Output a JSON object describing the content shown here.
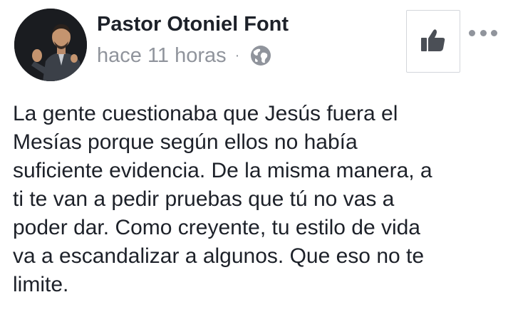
{
  "post": {
    "author": "Pastor Otoniel Font",
    "timestamp": "hace 11 horas",
    "separator": "·",
    "privacy_icon": "globe-icon",
    "avatar_icon": "profile-photo",
    "like_icon": "thumbs-up-icon",
    "more_icon": "more-options-icon",
    "text_lines": [
      "La gente cuestionaba que Jesús fuera el",
      "Mesías porque según ellos no había",
      "suficiente evidencia. De la misma manera, a",
      "ti te van a pedir pruebas que tú no vas a",
      "poder dar. Como creyente, tu estilo de vida",
      "va a escandalizar a algunos. Que eso no te",
      "limite."
    ]
  },
  "colors": {
    "text": "#1d2129",
    "meta": "#90949c",
    "like_icon": "#4b4f56",
    "border": "#d3d6db"
  }
}
